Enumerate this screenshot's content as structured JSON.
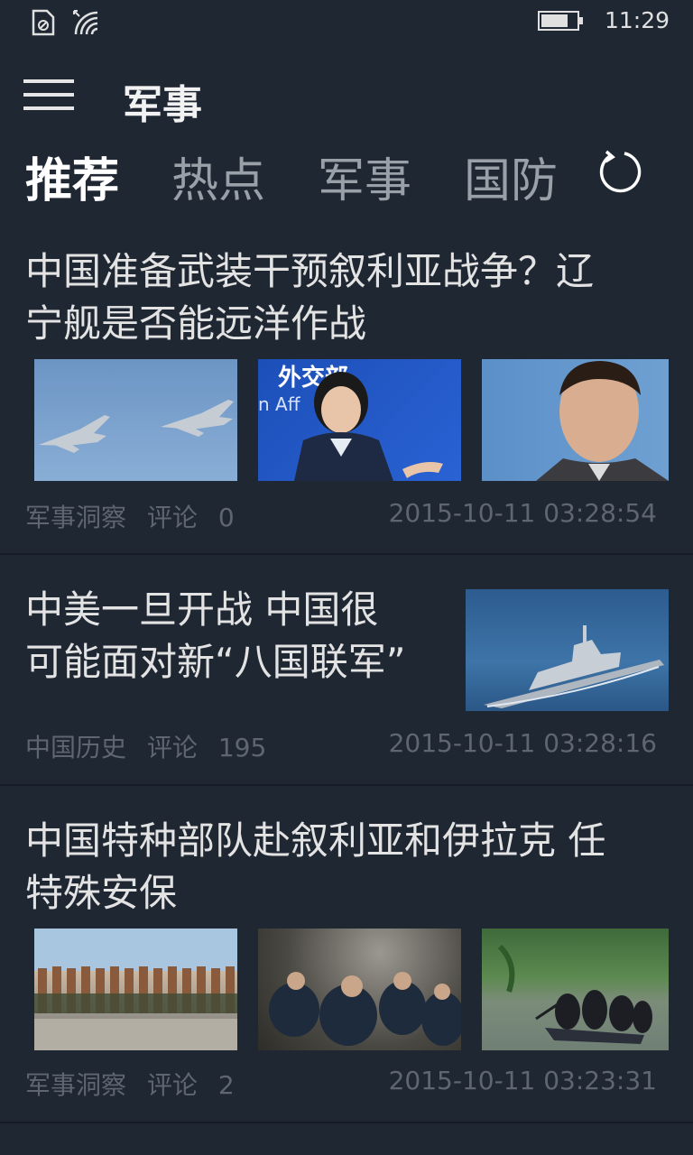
{
  "status_bar": {
    "time": "11:29",
    "battery_level": 0.7
  },
  "header": {
    "title": "军事"
  },
  "tabs": [
    {
      "label": "推荐",
      "active": true
    },
    {
      "label": "热点",
      "active": false
    },
    {
      "label": "军事",
      "active": false
    },
    {
      "label": "国防",
      "active": false
    }
  ],
  "articles": [
    {
      "title": "中国准备武装干预叙利亚战争？辽宁舰是否能远洋作战",
      "title_lines": [
        "中国准备武装干预叙利亚战争？辽",
        "宁舰是否能远洋作战"
      ],
      "source": "军事洞察",
      "comment_label": "评论",
      "comment_count": "0",
      "date": "2015-10-11 03:28:54",
      "thumbs": [
        "fighter-jets",
        "spokeswoman-podium",
        "syrian-leader-portrait"
      ],
      "thumb_banner_text": "外交部",
      "thumb_banner_text2": "n Aff"
    },
    {
      "title": "中美一旦开战 中国很可能面对新“八国联军”",
      "title_lines": [
        "中美一旦开战 中国很",
        "可能面对新“八国联军”"
      ],
      "source": "中国历史",
      "comment_label": "评论",
      "comment_count": "195",
      "date": "2015-10-11 03:28:16",
      "thumbs": [
        "destroyer-at-sea"
      ]
    },
    {
      "title": "中国特种部队赴叙利亚和伊拉克 任特殊安保",
      "title_lines": [
        "中国特种部队赴叙利亚和伊拉克 任",
        "特殊安保"
      ],
      "source": "军事洞察",
      "comment_label": "评论",
      "comment_count": "2",
      "date": "2015-10-11 03:23:31",
      "thumbs": [
        "soldiers-lineup",
        "soldiers-training",
        "soldiers-in-boat"
      ]
    }
  ],
  "colors": {
    "background": "#1f2733",
    "header_bg": "#232a36",
    "meta_text": "#5f6672",
    "title_text": "#e3e3e3"
  }
}
